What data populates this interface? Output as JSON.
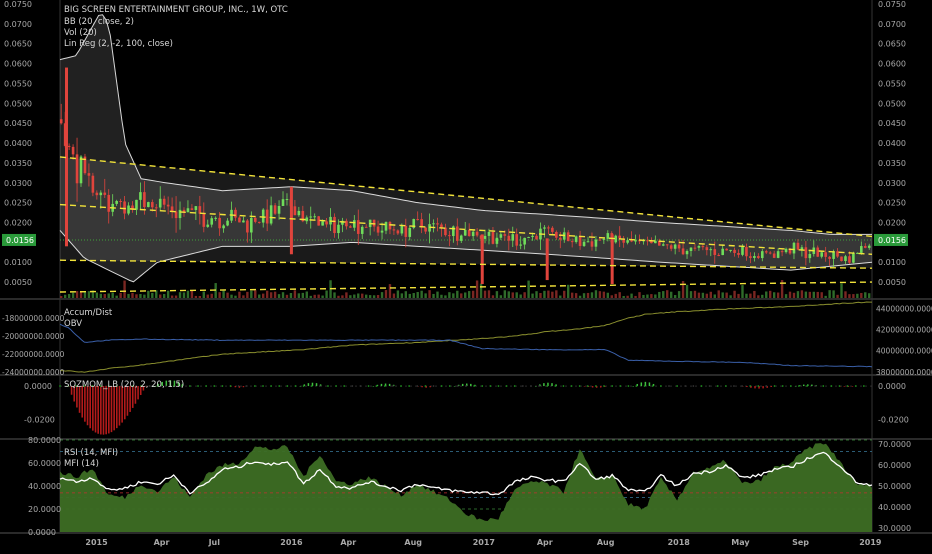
{
  "legend": {
    "title": "BIG SCREEN ENTERTAINMENT GROUP, INC., 1W, OTC",
    "bb": "BB (20, close, 2)",
    "vol": "Vol (20)",
    "linreg": "Lin Reg (2, -2, 100, close)",
    "accum": "Accum/Dist",
    "obv": "OBV",
    "sqz": "SQZMOM_LB (20, 2, 20, 1.5)",
    "rsi": "RSI (14, MFI)",
    "mfi": "MFI (14)"
  },
  "colors": {
    "background": "#000000",
    "up": "#6fdc5a",
    "down": "#e0443c",
    "bollinger": "#d8d8d8",
    "regression": "#f2e33a",
    "price_line": "#3fa33a",
    "accum": "#8a8f2e",
    "obv": "#3a5fa8",
    "rsi_line": "#ffffff",
    "mfi_fill": "#3d6e24"
  },
  "chart_data": [
    {
      "type": "candlestick",
      "title": "BIG SCREEN ENTERTAINMENT GROUP, INC., 1W, OTC",
      "ylim": [
        0.0025,
        0.075
      ],
      "yticks": [
        "0.0750",
        "0.0700",
        "0.0650",
        "0.0600",
        "0.0550",
        "0.0500",
        "0.0450",
        "0.0400",
        "0.0350",
        "0.0300",
        "0.0250",
        "0.0200",
        "0.0150",
        "0.0100",
        "0.0050"
      ],
      "yticks_left": [
        "0.0750",
        "0.0700",
        "0.0650",
        "0.0600",
        "0.0550",
        "0.0500",
        "0.0450",
        "0.0400",
        "0.0350",
        "0.0300",
        "0.0250",
        "0.0200",
        "0.0100",
        "0.0050"
      ],
      "last_price": "0.0156",
      "xtick_labels": [
        "2015",
        "Apr",
        "Jul",
        "2016",
        "Apr",
        "Aug",
        "2017",
        "Apr",
        "Aug",
        "2018",
        "May",
        "Sep",
        "2019"
      ],
      "xtick_pos": [
        0.045,
        0.125,
        0.19,
        0.285,
        0.355,
        0.435,
        0.522,
        0.597,
        0.672,
        0.762,
        0.838,
        0.912,
        0.998
      ],
      "close_path": {
        "t": [
          0,
          0.01,
          0.02,
          0.04,
          0.06,
          0.08,
          0.11,
          0.14,
          0.17,
          0.2,
          0.23,
          0.26,
          0.285,
          0.3,
          0.33,
          0.36,
          0.4,
          0.44,
          0.48,
          0.522,
          0.56,
          0.6,
          0.64,
          0.672,
          0.7,
          0.74,
          0.78,
          0.82,
          0.86,
          0.9,
          0.94,
          0.97,
          1
        ],
        "v": [
          0.046,
          0.038,
          0.034,
          0.028,
          0.025,
          0.024,
          0.026,
          0.023,
          0.022,
          0.021,
          0.02,
          0.022,
          0.025,
          0.021,
          0.019,
          0.02,
          0.018,
          0.019,
          0.018,
          0.017,
          0.016,
          0.017,
          0.015,
          0.016,
          0.015,
          0.014,
          0.013,
          0.013,
          0.012,
          0.013,
          0.012,
          0.011,
          0.0156
        ]
      },
      "bb_upper": {
        "t": [
          0,
          0.02,
          0.05,
          0.06,
          0.08,
          0.1,
          0.13,
          0.2,
          0.285,
          0.36,
          0.44,
          0.522,
          0.6,
          0.672,
          0.74,
          0.82,
          0.9,
          0.95,
          1
        ],
        "v": [
          0.061,
          0.062,
          0.073,
          0.07,
          0.04,
          0.031,
          0.03,
          0.028,
          0.029,
          0.028,
          0.025,
          0.023,
          0.022,
          0.021,
          0.02,
          0.019,
          0.018,
          0.017,
          0.017
        ]
      },
      "bb_lower": {
        "t": [
          0,
          0.03,
          0.06,
          0.09,
          0.12,
          0.2,
          0.285,
          0.36,
          0.44,
          0.522,
          0.6,
          0.672,
          0.74,
          0.82,
          0.9,
          0.95,
          1
        ],
        "v": [
          0.018,
          0.011,
          0.008,
          0.005,
          0.01,
          0.014,
          0.014,
          0.015,
          0.014,
          0.013,
          0.012,
          0.011,
          0.01,
          0.009,
          0.008,
          0.009,
          0.01
        ]
      },
      "regression": {
        "center": [
          0.0245,
          0.012
        ],
        "upper": [
          0.0365,
          0.0165
        ],
        "lower": [
          0.0105,
          0.0085
        ],
        "outer_lower": [
          0.0025,
          0.005
        ]
      },
      "spikes": [
        {
          "t": 0.008,
          "lo": 0.014,
          "hi": 0.059,
          "dir": "down"
        },
        {
          "t": 0.285,
          "lo": 0.012,
          "hi": 0.029,
          "dir": "down"
        },
        {
          "t": 0.52,
          "lo": 0.0045,
          "hi": 0.017,
          "dir": "down"
        },
        {
          "t": 0.6,
          "lo": 0.0055,
          "hi": 0.016,
          "dir": "down"
        },
        {
          "t": 0.68,
          "lo": 0.0045,
          "hi": 0.017,
          "dir": "down"
        }
      ]
    },
    {
      "type": "line",
      "name": "Accum/Dist",
      "yticks_left": [
        "-18000000.0000",
        "-20000000.0000",
        "-22000000.0000",
        "-24000000.0000"
      ],
      "yticks_right": [
        "44000000.0000",
        "42000000.0000",
        "40000000.0000",
        "38000000.0000"
      ],
      "accum": {
        "t": [
          0,
          0.03,
          0.06,
          0.1,
          0.15,
          0.2,
          0.26,
          0.3,
          0.36,
          0.44,
          0.5,
          0.56,
          0.6,
          0.64,
          0.672,
          0.7,
          0.72,
          0.76,
          0.82,
          0.88,
          0.94,
          1
        ],
        "v": [
          -23800000,
          -24000000,
          -23600000,
          -23200000,
          -22600000,
          -22000000,
          -21700000,
          -21500000,
          -21000000,
          -20700000,
          -20400000,
          -20000000,
          -19500000,
          -19200000,
          -18800000,
          -18000000,
          -17600000,
          -17300000,
          -17000000,
          -16800000,
          -16500000,
          -16200000
        ]
      },
      "obv": {
        "t": [
          0,
          0.01,
          0.03,
          0.06,
          0.1,
          0.2,
          0.3,
          0.4,
          0.48,
          0.5,
          0.52,
          0.6,
          0.672,
          0.7,
          0.76,
          0.84,
          0.9,
          1
        ],
        "v": [
          42500000,
          42200000,
          40800000,
          41000000,
          41100000,
          41000000,
          41000000,
          41000000,
          41000000,
          40600000,
          40200000,
          40100000,
          40100000,
          39100000,
          39000000,
          38900000,
          38600000,
          38500000
        ]
      }
    },
    {
      "type": "bar",
      "name": "SQZMOM_LB (20, 2, 20, 1.5)",
      "yticks": [
        "0.0000",
        "-0.0200"
      ],
      "ylim": [
        -0.031,
        0.006
      ],
      "dip": {
        "t0": 0.01,
        "t1": 0.105,
        "min": -0.029
      },
      "bumps": [
        {
          "t": 0.135,
          "w": 0.04,
          "h": 0.0035,
          "dir": "up"
        },
        {
          "t": 0.22,
          "w": 0.02,
          "h": -0.001,
          "dir": "down"
        },
        {
          "t": 0.31,
          "w": 0.03,
          "h": 0.002,
          "dir": "up"
        },
        {
          "t": 0.4,
          "w": 0.03,
          "h": 0.0015,
          "dir": "up"
        },
        {
          "t": 0.45,
          "w": 0.02,
          "h": -0.001,
          "dir": "down"
        },
        {
          "t": 0.5,
          "w": 0.03,
          "h": 0.0015,
          "dir": "up"
        },
        {
          "t": 0.6,
          "w": 0.03,
          "h": 0.002,
          "dir": "up"
        },
        {
          "t": 0.66,
          "w": 0.03,
          "h": -0.001,
          "dir": "down"
        },
        {
          "t": 0.72,
          "w": 0.03,
          "h": 0.0025,
          "dir": "up"
        },
        {
          "t": 0.86,
          "w": 0.04,
          "h": -0.0015,
          "dir": "down"
        },
        {
          "t": 0.92,
          "w": 0.03,
          "h": 0.001,
          "dir": "up"
        },
        {
          "t": 0.97,
          "w": 0.02,
          "h": -0.0005,
          "dir": "down"
        }
      ]
    },
    {
      "type": "area",
      "name": "RSI (14, MFI)",
      "yticks_left": [
        "80.0000",
        "60.0000",
        "40.0000",
        "20.0000",
        "0.0000"
      ],
      "yticks_right": [
        "70.0000",
        "60.0000",
        "50.0000",
        "40.0000",
        "30.0000"
      ],
      "ylim": [
        0,
        80
      ],
      "levels": [
        80,
        70,
        30,
        20
      ],
      "mfi": {
        "t": [
          0,
          0.02,
          0.04,
          0.06,
          0.08,
          0.1,
          0.12,
          0.14,
          0.16,
          0.18,
          0.2,
          0.22,
          0.24,
          0.26,
          0.28,
          0.3,
          0.32,
          0.34,
          0.36,
          0.38,
          0.4,
          0.42,
          0.44,
          0.46,
          0.48,
          0.5,
          0.52,
          0.54,
          0.56,
          0.58,
          0.6,
          0.62,
          0.64,
          0.66,
          0.68,
          0.7,
          0.72,
          0.74,
          0.76,
          0.78,
          0.8,
          0.82,
          0.84,
          0.86,
          0.88,
          0.9,
          0.92,
          0.94,
          0.96,
          0.98,
          1
        ],
        "v": [
          52,
          48,
          55,
          32,
          30,
          42,
          35,
          48,
          30,
          50,
          58,
          60,
          74,
          72,
          74,
          48,
          68,
          44,
          42,
          48,
          40,
          32,
          42,
          35,
          28,
          16,
          10,
          12,
          36,
          44,
          42,
          35,
          72,
          45,
          50,
          24,
          20,
          46,
          28,
          52,
          55,
          62,
          42,
          44,
          56,
          60,
          72,
          78,
          62,
          42,
          40
        ]
      },
      "rsi": {
        "t": [
          0,
          0.02,
          0.04,
          0.06,
          0.08,
          0.1,
          0.12,
          0.14,
          0.16,
          0.18,
          0.2,
          0.22,
          0.24,
          0.26,
          0.28,
          0.3,
          0.32,
          0.34,
          0.36,
          0.38,
          0.4,
          0.42,
          0.44,
          0.46,
          0.48,
          0.5,
          0.52,
          0.54,
          0.56,
          0.58,
          0.6,
          0.62,
          0.64,
          0.66,
          0.68,
          0.7,
          0.72,
          0.74,
          0.76,
          0.78,
          0.8,
          0.82,
          0.84,
          0.86,
          0.88,
          0.9,
          0.92,
          0.94,
          0.96,
          0.98,
          1
        ],
        "v": [
          54,
          52,
          54,
          48,
          49,
          52,
          51,
          55,
          47,
          51,
          58,
          59,
          62,
          60,
          62,
          51,
          58,
          50,
          49,
          52,
          50,
          48,
          51,
          49,
          48,
          47,
          47,
          46,
          52,
          54,
          53,
          52,
          61,
          53,
          55,
          48,
          47,
          55,
          50,
          56,
          57,
          60,
          54,
          55,
          58,
          59,
          63,
          66,
          60,
          52,
          50
        ]
      }
    }
  ]
}
